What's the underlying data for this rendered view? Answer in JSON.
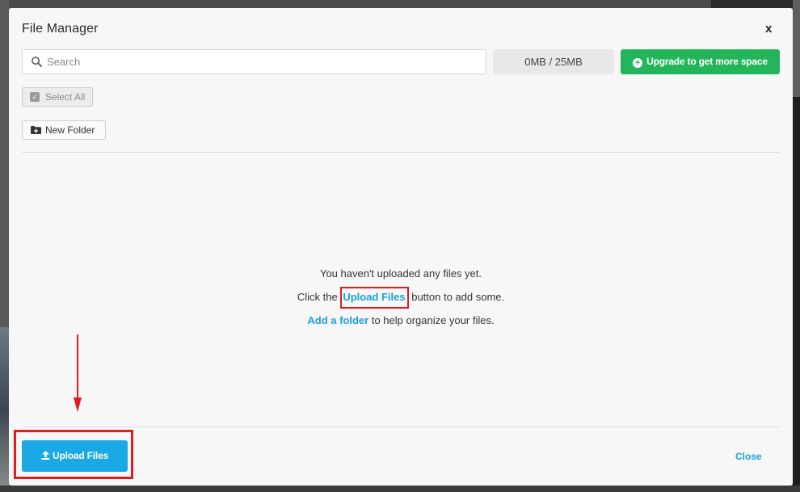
{
  "modal": {
    "title": "File Manager",
    "close_x": "x",
    "search": {
      "placeholder": "Search",
      "value": ""
    },
    "quota": "0MB / 25MB",
    "upgrade_label": "Upgrade to get more space",
    "select_all_label": "Select All",
    "new_folder_label": "New Folder",
    "empty_state": {
      "line1": "You haven't uploaded any files yet.",
      "line2_prefix": "Click the",
      "line2_link": "Upload Files",
      "line2_suffix": "button to add some.",
      "line3_link": "Add a folder",
      "line3_suffix": "to help organize your files."
    },
    "footer": {
      "upload_label": "Upload Files",
      "close_label": "Close"
    }
  },
  "colors": {
    "accent_blue": "#1aa9e4",
    "link_blue": "#1aa0d8",
    "upgrade_green": "#24b55b",
    "highlight_red": "#e21b1b"
  },
  "icons": [
    "search-icon",
    "plus-circle-icon",
    "checkbox-icon",
    "folder-plus-icon",
    "upload-icon",
    "close-icon",
    "arrow-down-icon"
  ]
}
